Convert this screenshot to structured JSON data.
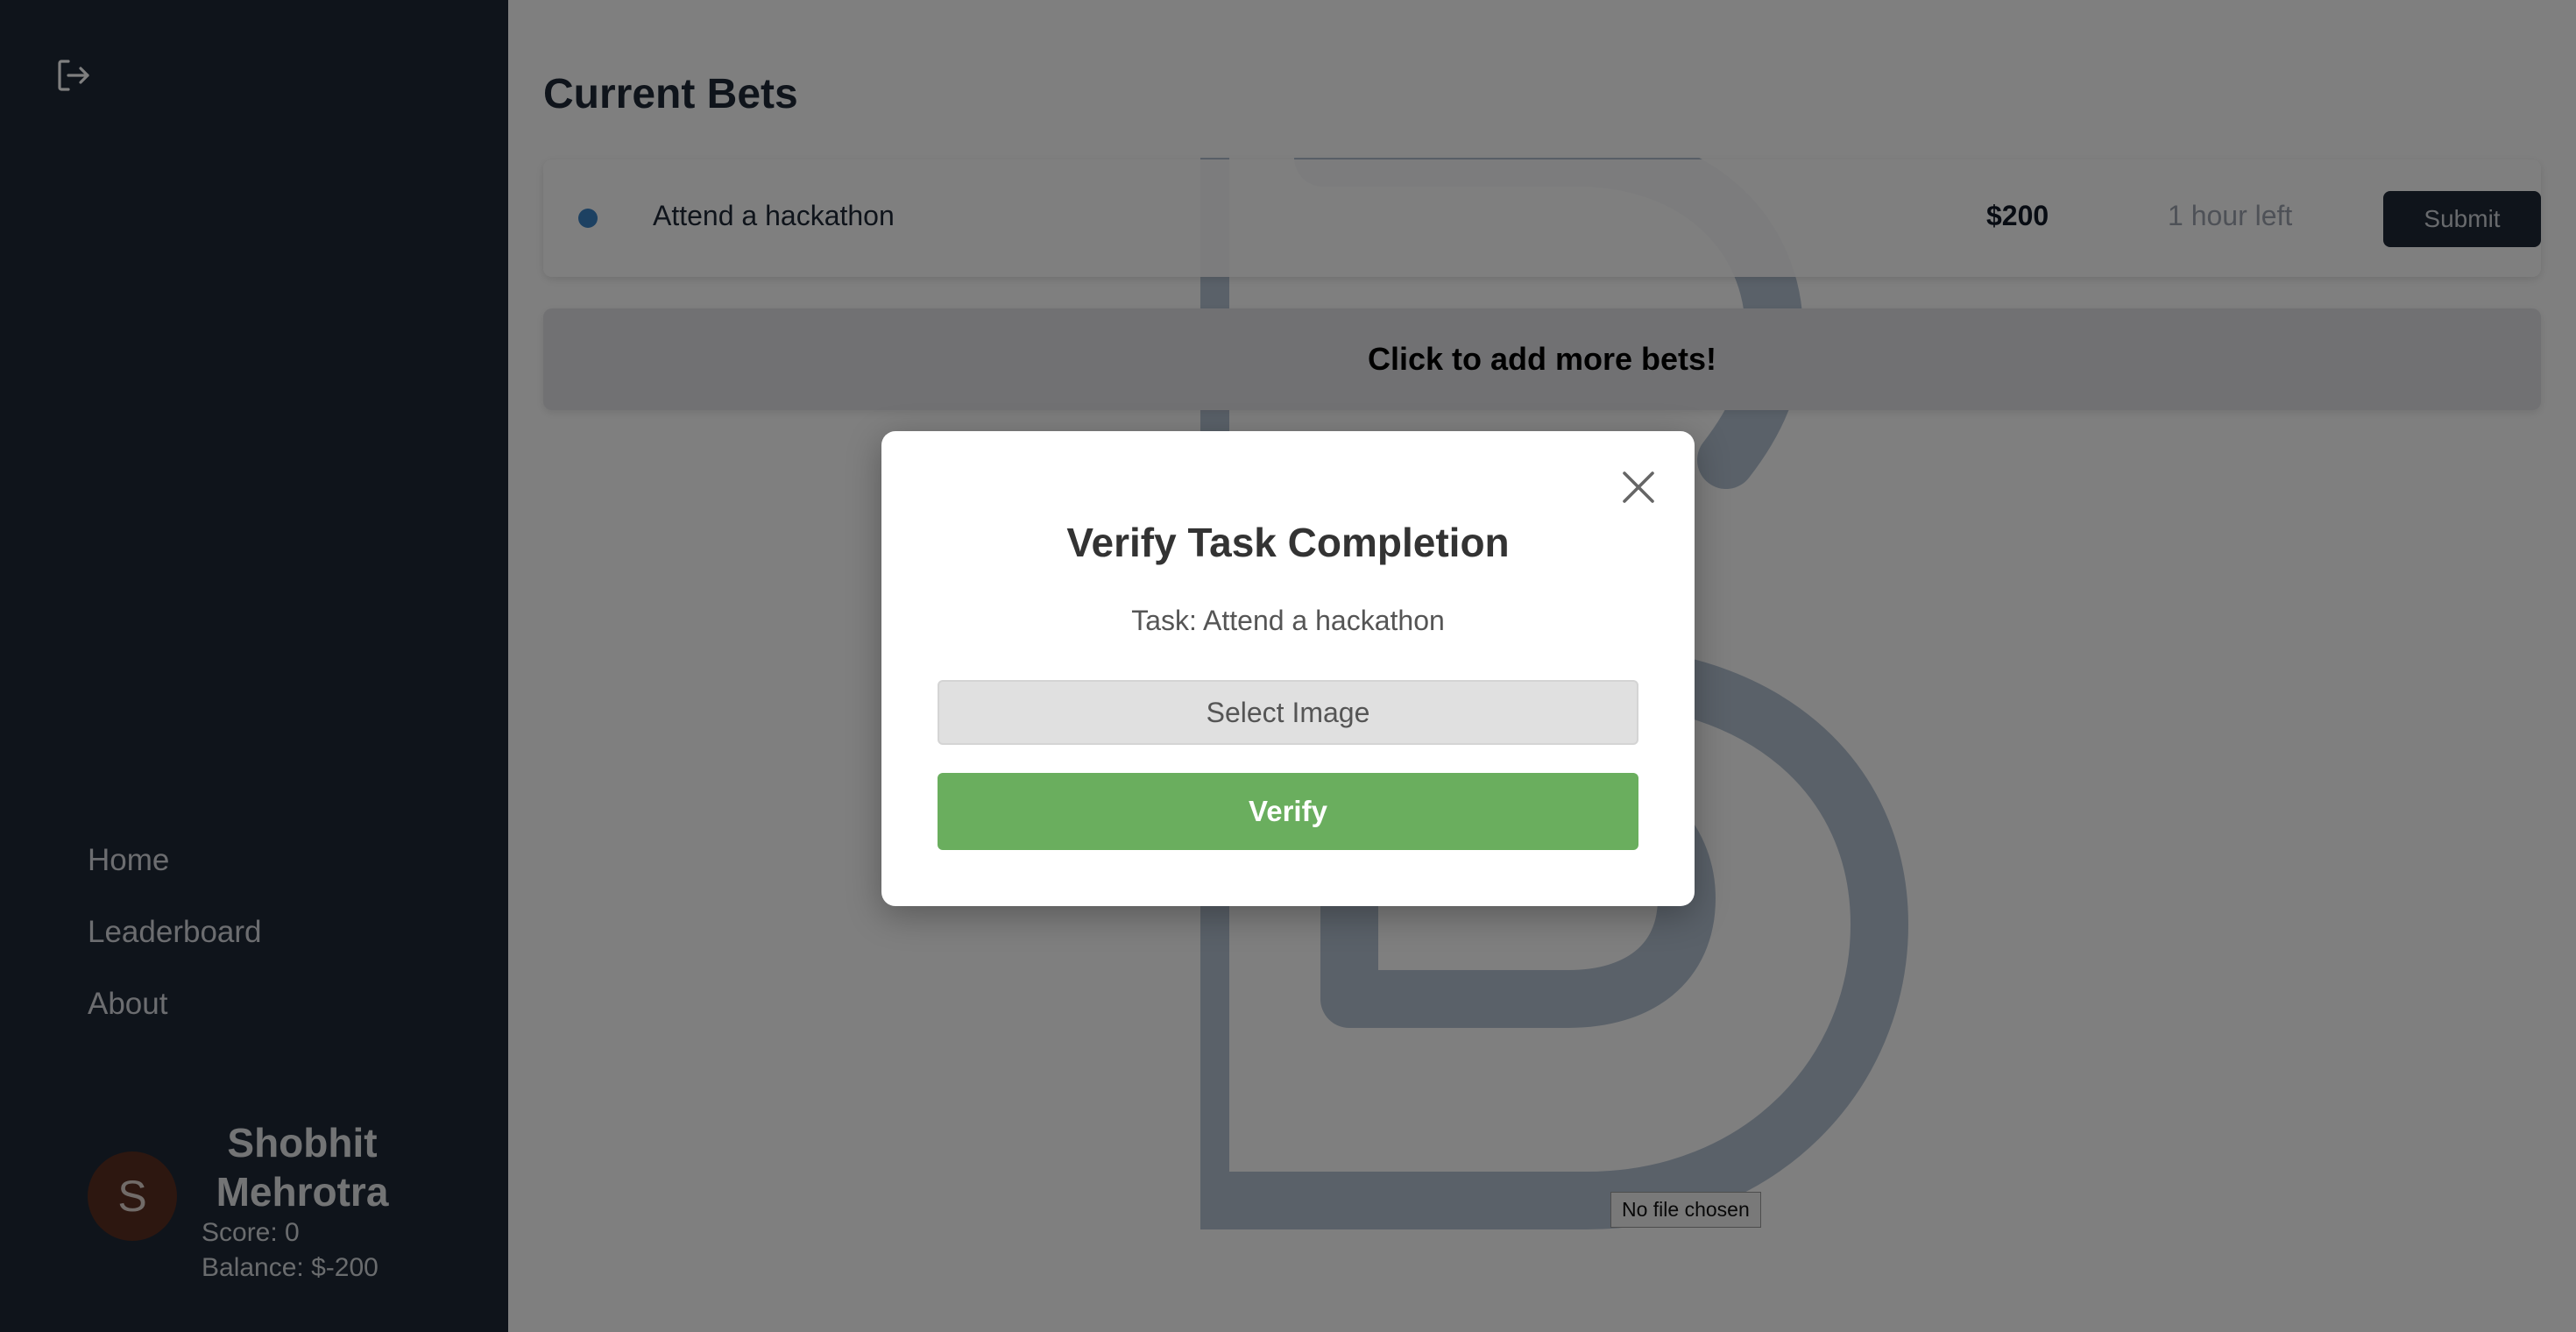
{
  "sidebar": {
    "logout_icon": "logout-icon",
    "nav": {
      "items": [
        {
          "label": "Home"
        },
        {
          "label": "Leaderboard"
        },
        {
          "label": "About"
        }
      ]
    },
    "profile": {
      "avatar_initial": "S",
      "name": "Shobhit Mehrotra",
      "score": "Score: 0",
      "balance": "Balance: $-200"
    }
  },
  "main": {
    "title": "Current Bets",
    "bets": [
      {
        "title": "Attend a hackathon",
        "amount": "$200",
        "time_left": "1 hour left",
        "submit_label": "Submit"
      }
    ],
    "add_bets_label": "Click to add more bets!",
    "file_input_status": "No file chosen"
  },
  "modal": {
    "title": "Verify Task Completion",
    "task_text": "Task: Attend a hackathon",
    "select_image_label": "Select Image",
    "verify_label": "Verify",
    "close_icon": "close-icon"
  },
  "colors": {
    "sidebar_bg": "#1f2937",
    "verify_green": "#6aae5e",
    "bet_dot_blue": "#3b82c4",
    "avatar_bg": "#5a2e20"
  }
}
